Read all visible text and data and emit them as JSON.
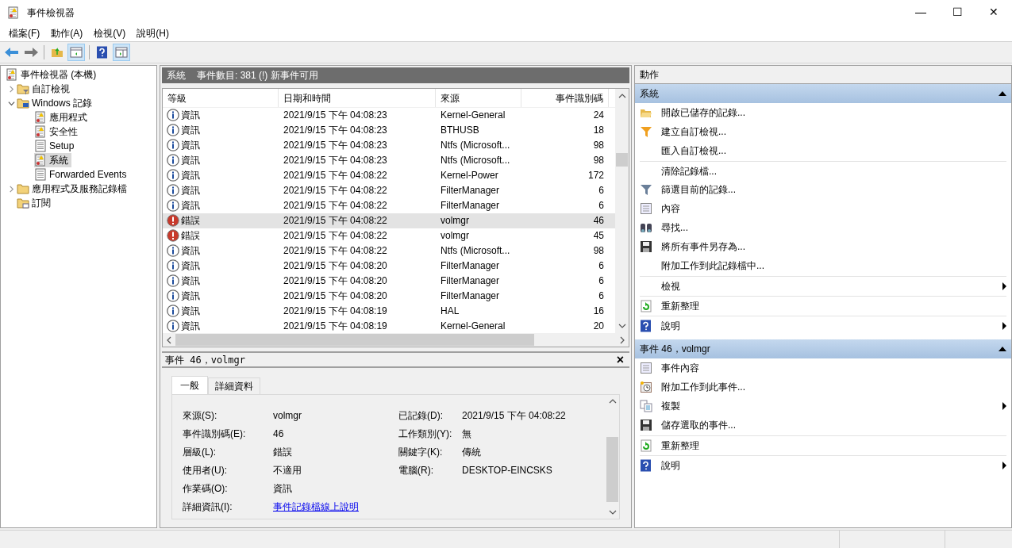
{
  "window": {
    "title": "事件檢視器",
    "controls": [
      "—",
      "☐",
      "✕"
    ]
  },
  "menu": [
    "檔案(F)",
    "動作(A)",
    "檢視(V)",
    "說明(H)"
  ],
  "toolbar": [
    {
      "kind": "back",
      "selected": false
    },
    {
      "kind": "forward",
      "selected": false
    },
    {
      "kind": "sep",
      "selected": false
    },
    {
      "kind": "up",
      "selected": false
    },
    {
      "kind": "tree",
      "selected": true
    },
    {
      "kind": "sep",
      "selected": false
    },
    {
      "kind": "help",
      "selected": false
    },
    {
      "kind": "actions",
      "selected": true
    }
  ],
  "tree": [
    {
      "label": "事件檢視器 (本機)",
      "kind": "log",
      "selected": false,
      "children": [
        {
          "label": "自訂檢視",
          "kind": "filter-folder",
          "expanded": false,
          "selected": false
        },
        {
          "label": "Windows 記錄",
          "kind": "pc-folder",
          "expanded": true,
          "selected": false,
          "children": [
            {
              "label": "應用程式",
              "kind": "log",
              "selected": false
            },
            {
              "label": "安全性",
              "kind": "log",
              "selected": false
            },
            {
              "label": "Setup",
              "kind": "plain-log",
              "selected": false
            },
            {
              "label": "系統",
              "kind": "log",
              "selected": true
            },
            {
              "label": "Forwarded Events",
              "kind": "plain-log",
              "selected": false
            }
          ]
        },
        {
          "label": "應用程式及服務記錄檔",
          "kind": "folder",
          "expanded": false,
          "selected": false
        },
        {
          "label": "訂閱",
          "kind": "sub-folder",
          "selected": false
        }
      ]
    }
  ],
  "log_header": {
    "name": "系統",
    "summary": "事件數目: 381 (!) 新事件可用"
  },
  "table": {
    "columns": [
      "等級",
      "日期和時間",
      "來源",
      "事件識別碼"
    ],
    "rows": [
      {
        "kind": "info",
        "level": "資訊",
        "date": "2021/9/15 下午 04:08:23",
        "source": "Kernel-General",
        "id": "24",
        "selected": false
      },
      {
        "kind": "info",
        "level": "資訊",
        "date": "2021/9/15 下午 04:08:23",
        "source": "BTHUSB",
        "id": "18",
        "selected": false
      },
      {
        "kind": "info",
        "level": "資訊",
        "date": "2021/9/15 下午 04:08:23",
        "source": "Ntfs (Microsoft...",
        "id": "98",
        "selected": false
      },
      {
        "kind": "info",
        "level": "資訊",
        "date": "2021/9/15 下午 04:08:23",
        "source": "Ntfs (Microsoft...",
        "id": "98",
        "selected": false
      },
      {
        "kind": "info",
        "level": "資訊",
        "date": "2021/9/15 下午 04:08:22",
        "source": "Kernel-Power",
        "id": "172",
        "selected": false
      },
      {
        "kind": "info",
        "level": "資訊",
        "date": "2021/9/15 下午 04:08:22",
        "source": "FilterManager",
        "id": "6",
        "selected": false
      },
      {
        "kind": "info",
        "level": "資訊",
        "date": "2021/9/15 下午 04:08:22",
        "source": "FilterManager",
        "id": "6",
        "selected": false
      },
      {
        "kind": "error",
        "level": "錯誤",
        "date": "2021/9/15 下午 04:08:22",
        "source": "volmgr",
        "id": "46",
        "selected": true
      },
      {
        "kind": "error",
        "level": "錯誤",
        "date": "2021/9/15 下午 04:08:22",
        "source": "volmgr",
        "id": "45",
        "selected": false
      },
      {
        "kind": "info",
        "level": "資訊",
        "date": "2021/9/15 下午 04:08:22",
        "source": "Ntfs (Microsoft...",
        "id": "98",
        "selected": false
      },
      {
        "kind": "info",
        "level": "資訊",
        "date": "2021/9/15 下午 04:08:20",
        "source": "FilterManager",
        "id": "6",
        "selected": false
      },
      {
        "kind": "info",
        "level": "資訊",
        "date": "2021/9/15 下午 04:08:20",
        "source": "FilterManager",
        "id": "6",
        "selected": false
      },
      {
        "kind": "info",
        "level": "資訊",
        "date": "2021/9/15 下午 04:08:20",
        "source": "FilterManager",
        "id": "6",
        "selected": false
      },
      {
        "kind": "info",
        "level": "資訊",
        "date": "2021/9/15 下午 04:08:19",
        "source": "HAL",
        "id": "16",
        "selected": false
      },
      {
        "kind": "info",
        "level": "資訊",
        "date": "2021/9/15 下午 04:08:19",
        "source": "Kernel-General",
        "id": "20",
        "selected": false
      }
    ]
  },
  "detail": {
    "title": "事件 46，volmgr",
    "close": "×",
    "tabs": [
      {
        "label": "一般",
        "selected": true
      },
      {
        "label": "詳細資料",
        "selected": false
      }
    ],
    "fields": [
      [
        {
          "label": "來源(S):",
          "value": "volmgr"
        },
        {
          "label": "已記錄(D):",
          "value": "2021/9/15 下午 04:08:22"
        }
      ],
      [
        {
          "label": "事件識別碼(E):",
          "value": "46"
        },
        {
          "label": "工作類別(Y):",
          "value": "無"
        }
      ],
      [
        {
          "label": "層級(L):",
          "value": "錯誤"
        },
        {
          "label": "關鍵字(K):",
          "value": "傳統"
        }
      ],
      [
        {
          "label": "使用者(U):",
          "value": "不適用"
        },
        {
          "label": "電腦(R):",
          "value": "DESKTOP-EINCSKS"
        }
      ],
      [
        {
          "label": "作業碼(O):",
          "value": "資訊"
        }
      ],
      [
        {
          "label": "詳細資訊(I):",
          "value": "事件記錄檔線上說明",
          "kind": "link"
        }
      ]
    ]
  },
  "actions": {
    "title": "動作",
    "sections": [
      {
        "title": "系統",
        "expanded": true,
        "items": [
          {
            "label": "開啟已儲存的記錄...",
            "kind": "open-folder",
            "submenu": false,
            "separator_before": false
          },
          {
            "label": "建立自訂檢視...",
            "kind": "funnel-gold",
            "submenu": false,
            "separator_before": false
          },
          {
            "label": "匯入自訂檢視...",
            "kind": "plain",
            "submenu": false,
            "separator_before": false
          },
          {
            "label": "清除記錄檔...",
            "kind": "plain",
            "submenu": false,
            "separator_before": true
          },
          {
            "label": "篩選目前的記錄...",
            "kind": "funnel",
            "submenu": false,
            "separator_before": false
          },
          {
            "label": "內容",
            "kind": "properties",
            "submenu": false,
            "separator_before": false
          },
          {
            "label": "尋找...",
            "kind": "binoculars",
            "submenu": false,
            "separator_before": false
          },
          {
            "label": "將所有事件另存為...",
            "kind": "save",
            "submenu": false,
            "separator_before": false
          },
          {
            "label": "附加工作到此記錄檔中...",
            "kind": "plain",
            "submenu": false,
            "separator_before": false
          },
          {
            "label": "檢視",
            "kind": "plain",
            "submenu": true,
            "separator_before": true
          },
          {
            "label": "重新整理",
            "kind": "refresh",
            "submenu": false,
            "separator_before": true
          },
          {
            "label": "說明",
            "kind": "help",
            "submenu": true,
            "separator_before": true
          }
        ]
      },
      {
        "title": "事件 46，volmgr",
        "expanded": true,
        "items": [
          {
            "label": "事件內容",
            "kind": "properties",
            "submenu": false,
            "separator_before": false
          },
          {
            "label": "附加工作到此事件...",
            "kind": "task",
            "submenu": false,
            "separator_before": false
          },
          {
            "label": "複製",
            "kind": "copy",
            "submenu": true,
            "separator_before": false
          },
          {
            "label": "儲存選取的事件...",
            "kind": "save",
            "submenu": false,
            "separator_before": false
          },
          {
            "label": "重新整理",
            "kind": "refresh",
            "submenu": false,
            "separator_before": true
          },
          {
            "label": "說明",
            "kind": "help",
            "submenu": true,
            "separator_before": true
          }
        ]
      }
    ]
  }
}
